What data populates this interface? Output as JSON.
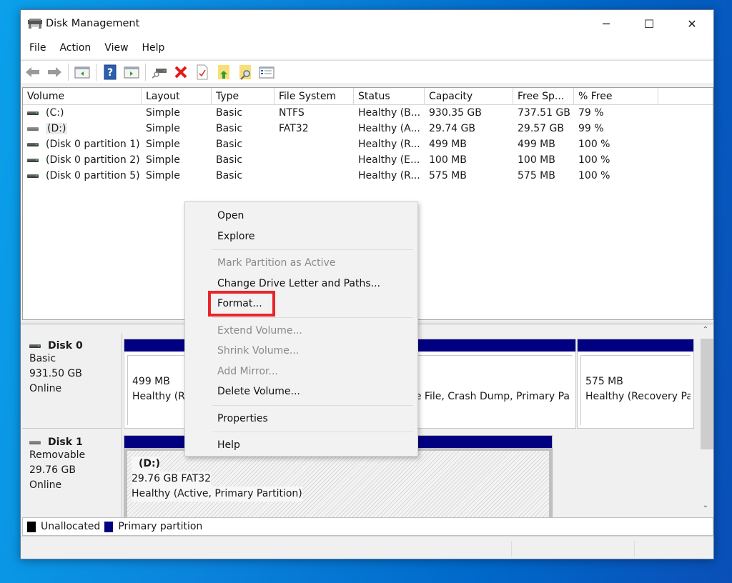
{
  "window": {
    "title": "Disk Management",
    "app_icon": "disk-management-icon",
    "controls": {
      "minimize": "─",
      "maximize": "☐",
      "close": "✕"
    }
  },
  "menu": [
    "File",
    "Action",
    "View",
    "Help"
  ],
  "toolbar": [
    {
      "name": "back-icon",
      "group": 0
    },
    {
      "name": "forward-icon",
      "group": 0
    },
    {
      "name": "show-hide-console-tree-icon",
      "group": 1
    },
    {
      "name": "help-icon",
      "group": 2
    },
    {
      "name": "show-hide-action-pane-icon",
      "group": 2
    },
    {
      "name": "connect-virtual-disk-icon",
      "group": 3
    },
    {
      "name": "delete-icon",
      "group": 3
    },
    {
      "name": "checklist-icon",
      "group": 3
    },
    {
      "name": "folder-up-icon",
      "group": 3
    },
    {
      "name": "folder-search-icon",
      "group": 3
    },
    {
      "name": "properties-list-icon",
      "group": 3
    }
  ],
  "volume_list": {
    "columns": [
      "Volume",
      "Layout",
      "Type",
      "File System",
      "Status",
      "Capacity",
      "Free Sp...",
      "% Free",
      ""
    ],
    "rows": [
      {
        "volume": "(C:)",
        "layout": "Simple",
        "type": "Basic",
        "fs": "NTFS",
        "status": "Healthy (B...",
        "capacity": "930.35 GB",
        "free": "737.51 GB",
        "pct": "79 %",
        "icon": "drive-icon"
      },
      {
        "volume": "(D:)",
        "layout": "Simple",
        "type": "Basic",
        "fs": "FAT32",
        "status": "Healthy (A...",
        "capacity": "29.74 GB",
        "free": "29.57 GB",
        "pct": "99 %",
        "icon": "removable-drive-icon",
        "selected": true
      },
      {
        "volume": "(Disk 0 partition 1)",
        "layout": "Simple",
        "type": "Basic",
        "fs": "",
        "status": "Healthy (R...",
        "capacity": "499 MB",
        "free": "499 MB",
        "pct": "100 %",
        "icon": "drive-icon"
      },
      {
        "volume": "(Disk 0 partition 2)",
        "layout": "Simple",
        "type": "Basic",
        "fs": "",
        "status": "Healthy (E...",
        "capacity": "100 MB",
        "free": "100 MB",
        "pct": "100 %",
        "icon": "drive-icon"
      },
      {
        "volume": "(Disk 0 partition 5)",
        "layout": "Simple",
        "type": "Basic",
        "fs": "",
        "status": "Healthy (R...",
        "capacity": "575 MB",
        "free": "575 MB",
        "pct": "100 %",
        "icon": "drive-icon"
      }
    ]
  },
  "disks": [
    {
      "name": "Disk 0",
      "kind": "Basic",
      "size": "931.50 GB",
      "state": "Online",
      "partitions": [
        {
          "line1": "499 MB",
          "line2": "Healthy (Re"
        },
        {
          "line1": "",
          "line2": "ge File, Crash Dump, Primary Pa"
        },
        {
          "line1": "575 MB",
          "line2": "Healthy (Recovery Pa"
        }
      ]
    },
    {
      "name": "Disk 1",
      "kind": "Removable",
      "size": "29.76 GB",
      "state": "Online",
      "partitions": [
        {
          "label": "(D:)",
          "line1": "29.76 GB FAT32",
          "line2": "Healthy (Active, Primary Partition)"
        }
      ]
    }
  ],
  "legend": [
    {
      "label": "Unallocated",
      "color": "#000000"
    },
    {
      "label": "Primary partition",
      "color": "#000080"
    }
  ],
  "context_menu": {
    "items": [
      {
        "label": "Open",
        "enabled": true
      },
      {
        "label": "Explore",
        "enabled": true
      },
      {
        "sep": true
      },
      {
        "label": "Mark Partition as Active",
        "enabled": false
      },
      {
        "label": "Change Drive Letter and Paths...",
        "enabled": true
      },
      {
        "label": "Format...",
        "enabled": true,
        "highlighted": true
      },
      {
        "sep": true
      },
      {
        "label": "Extend Volume...",
        "enabled": false
      },
      {
        "label": "Shrink Volume...",
        "enabled": false
      },
      {
        "label": "Add Mirror...",
        "enabled": false
      },
      {
        "label": "Delete Volume...",
        "enabled": true
      },
      {
        "sep": true
      },
      {
        "label": "Properties",
        "enabled": true
      },
      {
        "sep": true
      },
      {
        "label": "Help",
        "enabled": true
      }
    ],
    "highlight_color": "#e8262c"
  }
}
